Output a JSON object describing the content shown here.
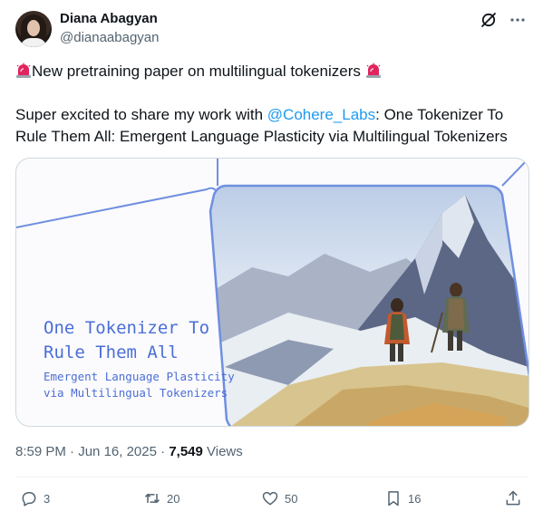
{
  "author": {
    "name": "Diana Abagyan",
    "handle": "@dianaabagyan"
  },
  "tweet": {
    "line1_text": "New pretraining paper on multilingual tokenizers",
    "line2_prefix": "Super excited to share my work with ",
    "mention": "@Cohere_Labs",
    "line2_suffix": ": One Tokenizer To",
    "line3_text": "Rule Them All: Emergent Language Plasticity via Multilingual Tokenizers"
  },
  "media": {
    "title": "One Tokenizer To\nRule Them All",
    "subtitle": "Emergent Language Plasticity\nvia Multilingual Tokenizers"
  },
  "meta": {
    "time": "8:59 PM",
    "sep1": " · ",
    "date": "Jun 16, 2025",
    "sep2": " · ",
    "views_count": "7,549",
    "views_label": " Views"
  },
  "actions": {
    "replies": "3",
    "reposts": "20",
    "likes": "50",
    "bookmarks": "16"
  },
  "icons": {
    "siren": "siren-emoji-icon",
    "grok": "grok-icon",
    "more": "more-icon",
    "reply": "reply-icon",
    "repost": "repost-icon",
    "like": "like-icon",
    "bookmark": "bookmark-icon",
    "share": "share-icon"
  },
  "colors": {
    "text": "#0f1419",
    "muted": "#536471",
    "link": "#1d9bf0",
    "media_accent": "#4b6ed6"
  }
}
